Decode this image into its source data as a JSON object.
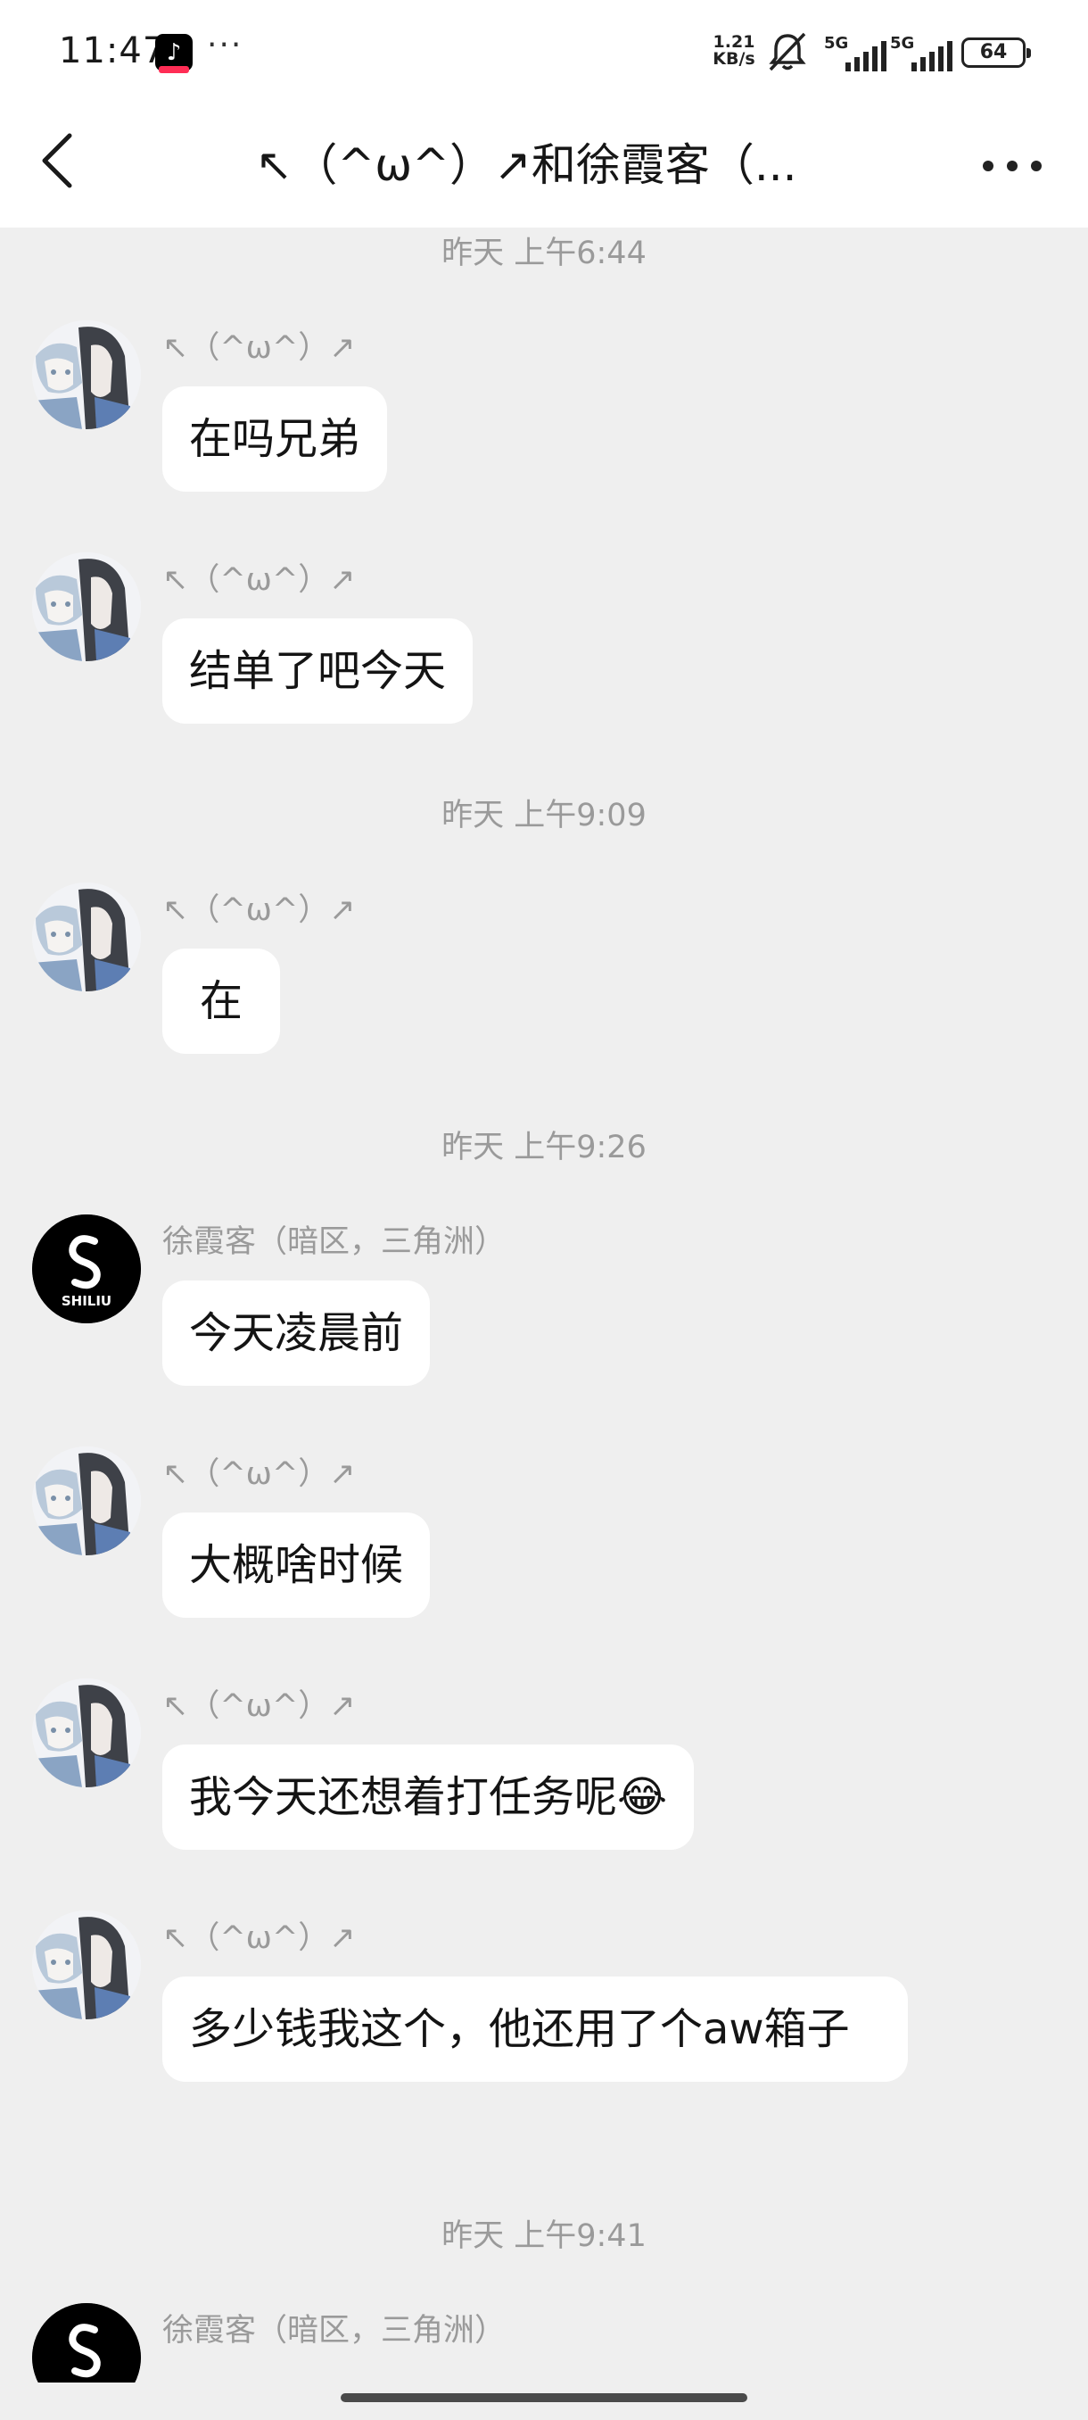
{
  "status_bar": {
    "time": "11:47",
    "app_icon": "tiktok-icon",
    "more": "···",
    "speed_value": "1.21",
    "speed_unit": "KB/s",
    "signal1_label": "5G",
    "signal2_label": "5G",
    "battery": "64"
  },
  "header": {
    "title": "↖（^ω^）↗和徐霞客（...",
    "back_icon": "chevron-left-icon",
    "more_icon": "more-horizontal-icon"
  },
  "messages": [
    {
      "type": "time",
      "text": "昨天 上午6:44"
    },
    {
      "type": "msg",
      "sender": "↖（^ω^）↗",
      "avatar": "anime",
      "text": "在吗兄弟"
    },
    {
      "type": "msg",
      "sender": "↖（^ω^）↗",
      "avatar": "anime",
      "text": "结单了吧今天"
    },
    {
      "type": "time",
      "text": "昨天 上午9:09"
    },
    {
      "type": "msg",
      "sender": "↖（^ω^）↗",
      "avatar": "anime",
      "text": "在"
    },
    {
      "type": "time",
      "text": "昨天 上午9:26"
    },
    {
      "type": "msg",
      "sender": "徐霞客（暗区，三角洲）",
      "avatar": "logo",
      "text": "今天凌晨前"
    },
    {
      "type": "msg",
      "sender": "↖（^ω^）↗",
      "avatar": "anime",
      "text": "大概啥时候"
    },
    {
      "type": "msg",
      "sender": "↖（^ω^）↗",
      "avatar": "anime",
      "text": "我今天还想着打任务呢😂"
    },
    {
      "type": "msg",
      "sender": "↖（^ω^）↗",
      "avatar": "anime",
      "text": "多少钱我这个，他还用了个aw箱子"
    },
    {
      "type": "time",
      "text": "昨天 上午9:41"
    },
    {
      "type": "msg",
      "sender": "徐霞客（暗区，三角洲）",
      "avatar": "logo",
      "text": ""
    }
  ],
  "logo_text": "SHILIU",
  "colors": {
    "background": "#efefef",
    "bubble": "#ffffff",
    "meta_text": "#9a9a9a"
  }
}
